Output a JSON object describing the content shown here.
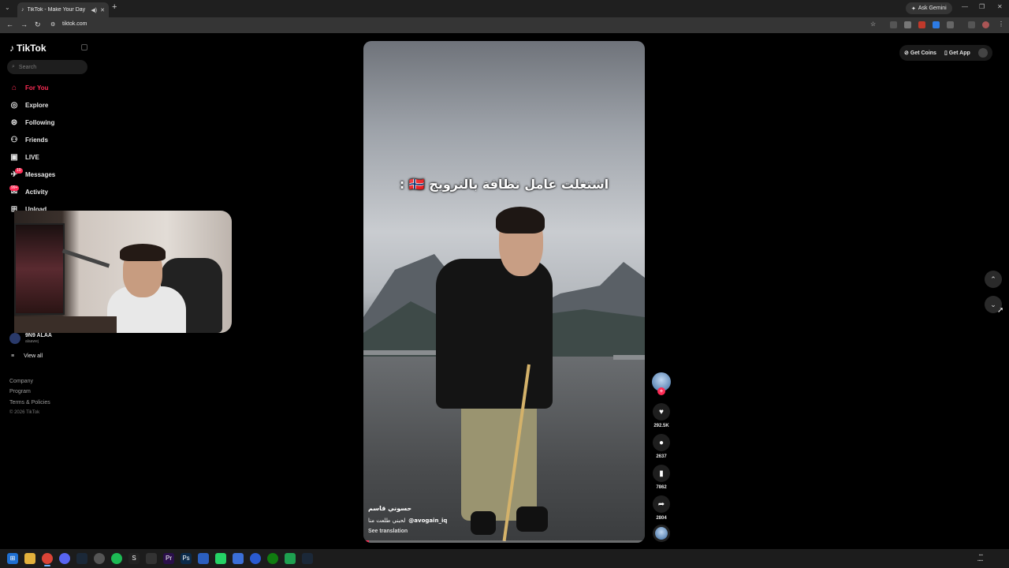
{
  "browser": {
    "tab_title": "TikTok - Make Your Day",
    "url": "tiktok.com",
    "gemini_label": "Ask Gemini"
  },
  "sidebar": {
    "logo": "TikTok",
    "search_placeholder": "Search",
    "items": [
      {
        "label": "For You",
        "icon": "home-icon",
        "active": true
      },
      {
        "label": "Explore",
        "icon": "compass-icon"
      },
      {
        "label": "Following",
        "icon": "following-icon"
      },
      {
        "label": "Friends",
        "icon": "friends-icon"
      },
      {
        "label": "LIVE",
        "icon": "live-icon"
      },
      {
        "label": "Messages",
        "icon": "messages-icon",
        "badge": "10"
      },
      {
        "label": "Activity",
        "icon": "activity-icon",
        "badge": "99+"
      },
      {
        "label": "Upload",
        "icon": "upload-icon"
      }
    ],
    "following_account": {
      "name": "9N9 ALAA",
      "handle": "alaawej"
    },
    "view_all": "View all",
    "footer": [
      "Company",
      "Program",
      "Terms & Policies"
    ],
    "copyright": "© 2026 TikTok"
  },
  "video": {
    "overlay_text": "اشتغلت عامل نظافة بالنرويج 🇳🇴 :",
    "author": "حسوني قاسم",
    "description": "لحبني طلعت منا",
    "mention": "@avogain_iq",
    "see_translation": "See translation",
    "progress_fraction": 0.02
  },
  "actions": {
    "likes": "292.5K",
    "comments": "2637",
    "saves": "7862",
    "shares": "2804"
  },
  "header_right": {
    "get_coins": "Get Coins",
    "get_app": "Get App"
  },
  "colors": {
    "accent": "#fe2c55",
    "background": "#000000"
  }
}
